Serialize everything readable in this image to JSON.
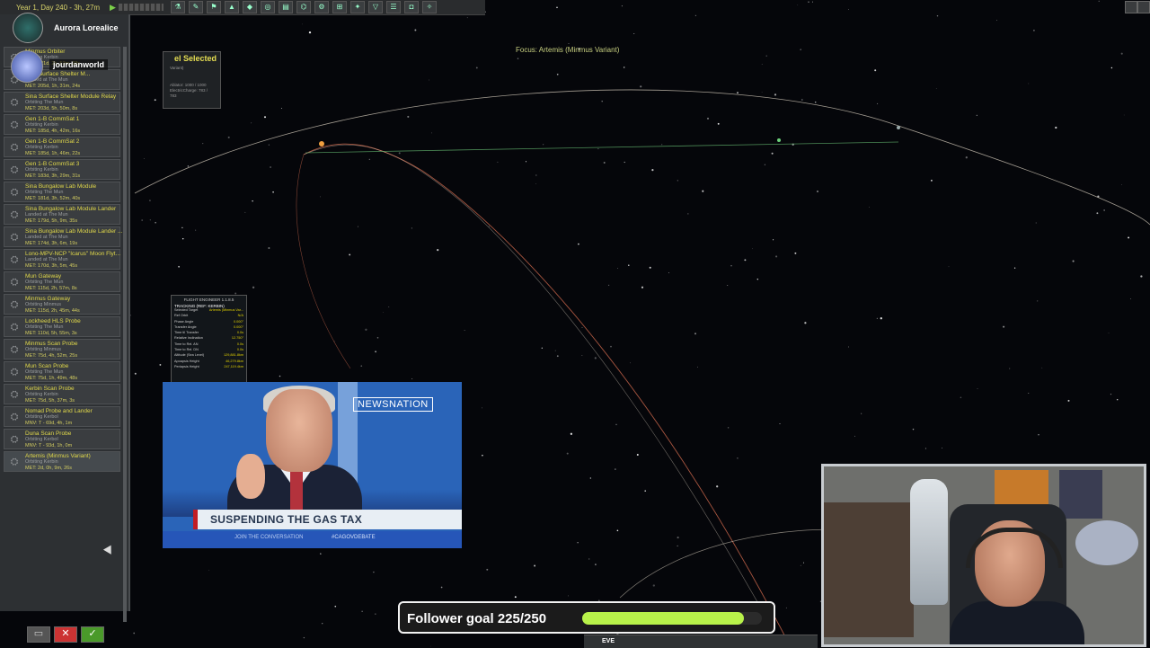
{
  "topbar": {
    "date": "Year 1, Day 240 - 3h, 27m",
    "icons": [
      "science-icon",
      "wrench-icon",
      "flag-icon",
      "rocket-icon",
      "node-icon",
      "target-icon",
      "chart-icon",
      "antenna-icon"
    ]
  },
  "streamer": {
    "name": "Aurora Lorealice",
    "secondary_name": "jourdanworld"
  },
  "vessels": [
    {
      "name": "Minmus Orbiter",
      "situation": "Orbiting Kerbin",
      "met": "MET: 221d, 2h, 53m, 28s"
    },
    {
      "name": "Sina Surface Shelter M...",
      "situation": "Landed at The Mun",
      "met": "MET: 205d, 1h, 31m, 24s"
    },
    {
      "name": "Sina Surface Shelter Module Relay",
      "situation": "Orbiting The Mun",
      "met": "MET: 203d, 5h, 50m, 8s"
    },
    {
      "name": "Gen 1-B CommSat 1",
      "situation": "Orbiting Kerbin",
      "met": "MET: 185d, 4h, 42m, 16s"
    },
    {
      "name": "Gen 1-B CommSat 2",
      "situation": "Orbiting Kerbin",
      "met": "MET: 185d, 1h, 46m, 22s"
    },
    {
      "name": "Gen 1-B CommSat 3",
      "situation": "Orbiting Kerbin",
      "met": "MET: 183d, 3h, 29m, 31s"
    },
    {
      "name": "Sina Bungalow Lab Module",
      "situation": "Orbiting The Mun",
      "met": "MET: 181d, 3h, 52m, 40s"
    },
    {
      "name": "Sina Bungalow Lab Module Lander",
      "situation": "Landed at The Mun",
      "met": "MET: 179d, 5h, 9m, 35s"
    },
    {
      "name": "Sina Bungalow Lab Module Lander ...",
      "situation": "Landed at The Mun",
      "met": "MET: 174d, 3h, 6m, 19s"
    },
    {
      "name": "Lono-MPV-NCP \"Icarus\" Moon Flyt...",
      "situation": "Landed at The Mun",
      "met": "MET: 170d, 3h, 5m, 45s"
    },
    {
      "name": "Mun Gateway",
      "situation": "Orbiting The Mun",
      "met": "MET: 115d, 2h, 57m, 8s"
    },
    {
      "name": "Minmus Gateway",
      "situation": "Orbiting Minmus",
      "met": "MET: 115d, 2h, 45m, 44s"
    },
    {
      "name": "Lockheed HLS Probe",
      "situation": "Orbiting The Mun",
      "met": "MET: 110d, 5h, 55m, 3s"
    },
    {
      "name": "Minmus Scan Probe",
      "situation": "Orbiting Minmus",
      "met": "MET: 75d, 4h, 52m, 25s"
    },
    {
      "name": "Mun Scan Probe",
      "situation": "Orbiting The Mun",
      "met": "MET: 75d, 1h, 49m, 48s"
    },
    {
      "name": "Kerbin Scan Probe",
      "situation": "Orbiting Kerbin",
      "met": "MET: 75d, 5h, 37m, 3s"
    },
    {
      "name": "Nomad Probe and Lander",
      "situation": "Orbiting Kerbol",
      "met": "MNV: T - 69d, 4h, 1m"
    },
    {
      "name": "Duna Scan Probe",
      "situation": "Orbiting Kerbol",
      "met": "MNV: T - 93d, 1h, 0m"
    },
    {
      "name": "Artemis (Minmus Variant)",
      "situation": "Orbiting Kerbin",
      "met": "MET: 2d, 0h, 9m, 26s"
    }
  ],
  "selected_panel": {
    "title": "el Selected",
    "subtitle": "Variant)",
    "line1": "Ablator: 1000 / 1000",
    "line2": "ElectricCharge: 783 /",
    "line3": "783"
  },
  "map": {
    "focus": "Focus: Artemis (Minmus Variant)"
  },
  "flight_engineer": {
    "header": "FLIGHT ENGINEER 1.1.8.5",
    "tracking": "TRACKING (REF: KERBIN)",
    "rows": [
      {
        "label": "Selected Target",
        "value": "Artemis (Minmus Var..."
      },
      {
        "label": "Ref Orbit",
        "value": "N/A"
      },
      {
        "label": "Phase Angle",
        "value": "0.000°"
      },
      {
        "label": "Transfer Angle",
        "value": "0.000°"
      },
      {
        "label": "Time til Transfer",
        "value": "0.0s"
      },
      {
        "label": "Relative Inclination",
        "value": "12.750°"
      },
      {
        "label": "Time to Rel. AN",
        "value": "0.0s"
      },
      {
        "label": "Time to Rel. DN",
        "value": "0.0s"
      },
      {
        "label": "Altitude (Sea Level)",
        "value": "129,881.8km"
      },
      {
        "label": "Apoapsis Height",
        "value": "46,279.8km"
      },
      {
        "label": "Periapsis Height",
        "value": "247,119.4km"
      }
    ]
  },
  "news": {
    "logo": "NEWSNATION",
    "headline": "SUSPENDING THE GAS TAX",
    "ticker_left": "JOIN THE CONVERSATION",
    "ticker_right": "#CAGOVDEBATE"
  },
  "follower_goal": {
    "label": "Follower goal 225/250",
    "current": 225,
    "target": 250,
    "bar_color": "#b8f24a"
  },
  "bottom_hud": {
    "planet": "EVE"
  },
  "colors": {
    "orbit_kerbin": "#d9d0c0",
    "orbit_trajectory": "#d26a4e",
    "orbit_target": "#5fae6a",
    "vessel_name": "#e0d84a"
  }
}
